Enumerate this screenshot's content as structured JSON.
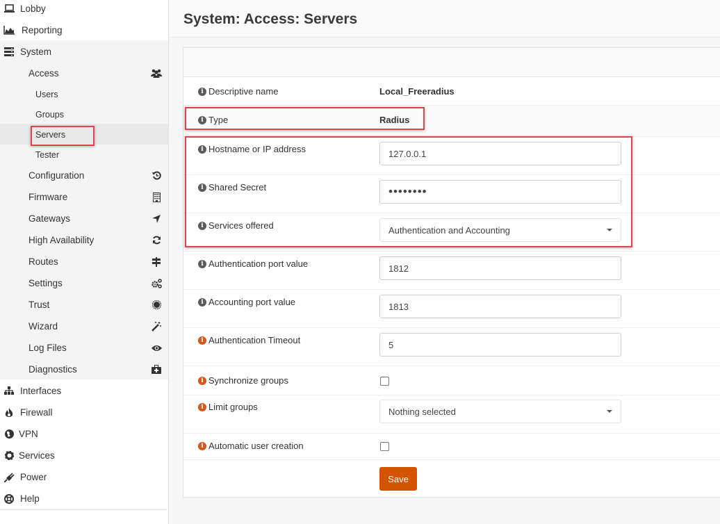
{
  "page": {
    "title": "System: Access: Servers"
  },
  "sidebar": {
    "top_items": [
      {
        "label": "Lobby",
        "icon": "laptop-icon"
      },
      {
        "label": "Reporting",
        "icon": "area-chart-icon"
      },
      {
        "label": "System",
        "icon": "server-icon"
      }
    ],
    "system_items": [
      {
        "label": "Access",
        "icon": "users-icon"
      },
      {
        "label": "Users"
      },
      {
        "label": "Groups"
      },
      {
        "label": "Servers",
        "active": true
      },
      {
        "label": "Tester"
      },
      {
        "label": "Configuration",
        "icon": "history-icon"
      },
      {
        "label": "Firmware",
        "icon": "building-icon"
      },
      {
        "label": "Gateways",
        "icon": "location-arrow-icon"
      },
      {
        "label": "High Availability",
        "icon": "refresh-icon"
      },
      {
        "label": "Routes",
        "icon": "map-signs-icon"
      },
      {
        "label": "Settings",
        "icon": "cogs-icon"
      },
      {
        "label": "Trust",
        "icon": "certificate-icon"
      },
      {
        "label": "Wizard",
        "icon": "magic-icon"
      },
      {
        "label": "Log Files",
        "icon": "eye-icon"
      },
      {
        "label": "Diagnostics",
        "icon": "medkit-icon"
      }
    ],
    "bottom_items": [
      {
        "label": "Interfaces",
        "icon": "sitemap-icon"
      },
      {
        "label": "Firewall",
        "icon": "fire-icon"
      },
      {
        "label": "VPN",
        "icon": "globe-icon"
      },
      {
        "label": "Services",
        "icon": "cog-icon"
      },
      {
        "label": "Power",
        "icon": "plug-icon"
      },
      {
        "label": "Help",
        "icon": "life-ring-icon"
      }
    ]
  },
  "form": {
    "descriptive_name": {
      "label": "Descriptive name",
      "value": "Local_Freeradius"
    },
    "type": {
      "label": "Type",
      "value": "Radius"
    },
    "hostname": {
      "label": "Hostname or IP address",
      "value": "127.0.0.1"
    },
    "shared_secret": {
      "label": "Shared Secret",
      "value": "••••••••"
    },
    "services_offered": {
      "label": "Services offered",
      "value": "Authentication and Accounting"
    },
    "auth_port": {
      "label": "Authentication port value",
      "value": "1812"
    },
    "acct_port": {
      "label": "Accounting port value",
      "value": "1813"
    },
    "auth_timeout": {
      "label": "Authentication Timeout",
      "value": "5"
    },
    "sync_groups": {
      "label": "Synchronize groups",
      "checked": false
    },
    "limit_groups": {
      "label": "Limit groups",
      "value": "Nothing selected"
    },
    "auto_user_creation": {
      "label": "Automatic user creation",
      "checked": false
    },
    "save_label": "Save",
    "info_glyph": "i"
  },
  "colors": {
    "accent": "#d35400",
    "highlight": "#e0434b",
    "info_gray": "#5c5c5c",
    "info_orange": "#d4581a"
  }
}
